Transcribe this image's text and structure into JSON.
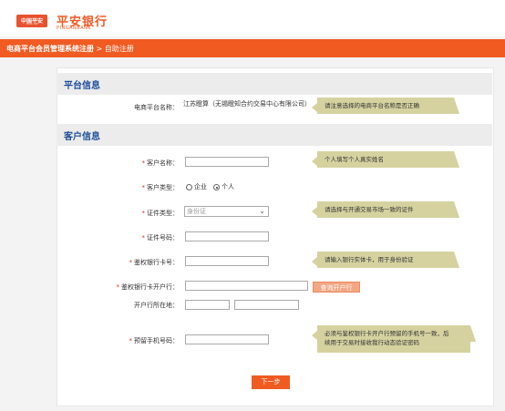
{
  "brand": {
    "badge": "中国平安",
    "badge_sub": "PING AN",
    "name_cn": "平安银行",
    "name_en": "PINGANBANK"
  },
  "breadcrumb": {
    "root": "电商平台会员管理系统注册",
    "separator": ">",
    "current": "自助注册"
  },
  "sections": {
    "platform_title": "平台信息",
    "customer_title": "客户信息"
  },
  "platform": {
    "label": "电商平台名称：",
    "value": "江苏瞪算（无锡瞪知合约交易中心有限公司）",
    "tip": "请注意选择的电商平台名称是否正确"
  },
  "form": {
    "customer_name": {
      "label": "客户名称：",
      "tip": "个人填写个人真实姓名"
    },
    "customer_type": {
      "label": "客户类型：",
      "options": [
        "企业",
        "个人"
      ],
      "selected": "个人"
    },
    "id_type": {
      "label": "证件类型：",
      "selected": "身份证",
      "tip": "请选择与开通交易市场一致的证件"
    },
    "id_number": {
      "label": "证件号码："
    },
    "bank_card": {
      "label": "鉴权银行卡号：",
      "tip": "请输入银行实体卡，用于身份验证"
    },
    "bank_branch": {
      "label": "鉴权银行卡开户行：",
      "query_button": "查询开户行"
    },
    "bank_location": {
      "label": "开户行所在地："
    },
    "phone": {
      "label": "预留手机号码：",
      "tip_line1": "必须与鉴权银行卡开户行预留的手机号一致，后",
      "tip_line2": "续用于交易时接收我行动态验证密码"
    },
    "required_mark": "*",
    "next_button": "下一步"
  },
  "colors": {
    "accent": "#f05b22",
    "section_title": "#1f4f99",
    "tip_bg": "#d5d2a0"
  }
}
